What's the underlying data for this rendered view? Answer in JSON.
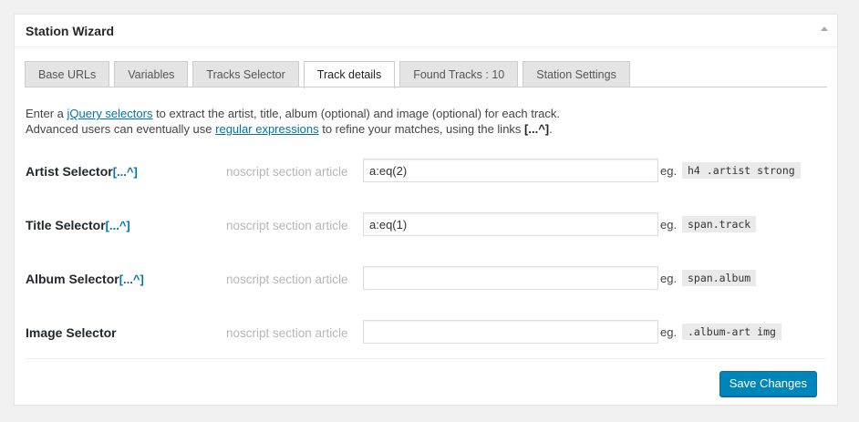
{
  "panel": {
    "title": "Station Wizard"
  },
  "tabs": [
    {
      "label": "Base URLs"
    },
    {
      "label": "Variables"
    },
    {
      "label": "Tracks Selector"
    },
    {
      "label": "Track details",
      "active": true
    },
    {
      "label": "Found Tracks : 10"
    },
    {
      "label": "Station Settings"
    }
  ],
  "intro": {
    "line1_pre": "Enter a ",
    "line1_link": "jQuery selectors",
    "line1_post": " to extract the artist, title, album (optional) and image (optional) for each track.",
    "line2_pre": "Advanced users can eventually use ",
    "line2_link": "regular expressions",
    "line2_mid": " to refine your matches, using the links ",
    "line2_bold": "[...^]",
    "line2_end": "."
  },
  "fields": [
    {
      "label": "Artist Selector",
      "regex_link": "[...^]",
      "hint": "noscript section article",
      "value": "a:eq(2)",
      "eg": "eg.",
      "example": "h4 .artist strong"
    },
    {
      "label": "Title Selector",
      "regex_link": "[...^]",
      "hint": "noscript section article",
      "value": "a:eq(1)",
      "eg": "eg.",
      "example": "span.track"
    },
    {
      "label": "Album Selector",
      "regex_link": "[...^]",
      "hint": "noscript section article",
      "value": "",
      "eg": "eg.",
      "example": "span.album"
    },
    {
      "label": "Image Selector",
      "regex_link": "",
      "hint": "noscript section article",
      "value": "",
      "eg": "eg.",
      "example": ".album-art img"
    }
  ],
  "actions": {
    "save_label": "Save Changes"
  },
  "colors": {
    "accent": "#0085ba",
    "link": "#0073aa"
  }
}
